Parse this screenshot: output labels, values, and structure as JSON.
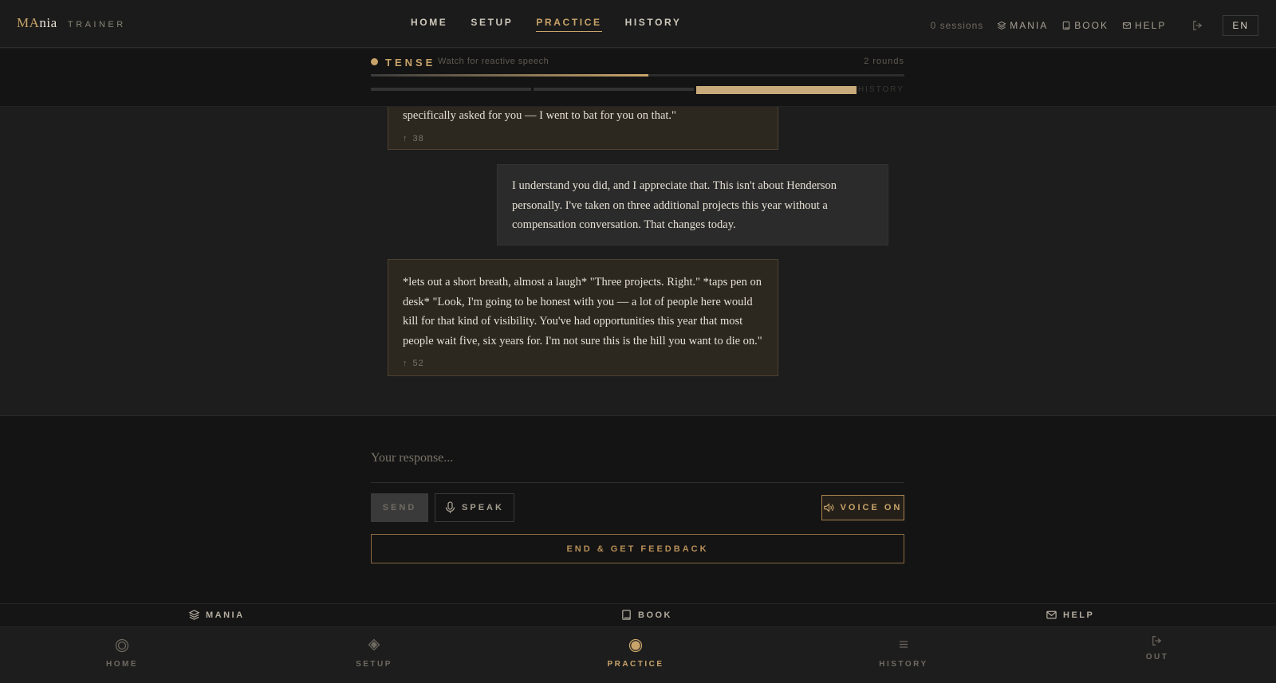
{
  "app": {
    "logo_ma": "MA",
    "logo_nia": "nia",
    "logo_sub": "TRAINER"
  },
  "topnav": [
    {
      "label": "HOME"
    },
    {
      "label": "SETUP"
    },
    {
      "label": "PRACTICE",
      "active": true
    },
    {
      "label": "HISTORY"
    }
  ],
  "topright": {
    "sessions": "0 sessions",
    "mania": "MANIA",
    "book": "BOOK",
    "help": "HELP",
    "lang": "EN"
  },
  "status": {
    "mood": "TENSE",
    "hint": "Watch for reactive speech",
    "rounds": "2 rounds",
    "progress": 0.52,
    "history_label": "HISTORY",
    "segments": [
      false,
      false,
      true
    ]
  },
  "messages": [
    {
      "role": "ai",
      "text": "specifically asked for you — I went to bat for you on that.\"",
      "votes": "38"
    },
    {
      "role": "me",
      "text": "I understand you did, and I appreciate that. This isn't about Henderson personally. I've taken on three additional projects this year without a compensation conversation. That changes today."
    },
    {
      "role": "ai",
      "text": "*lets out a short breath, almost a laugh* \"Three projects. Right.\" *taps pen on desk* \"Look, I'm going to be honest with you — a lot of people here would kill for that kind of visibility. You've had opportunities this year that most people wait five, six years for. I'm not sure this is the hill you want to die on.\"",
      "votes": "52"
    }
  ],
  "composer": {
    "placeholder": "Your response...",
    "send": "SEND",
    "speak": "SPEAK",
    "voice": "VOICE ON",
    "end": "END & GET FEEDBACK"
  },
  "footer_links": {
    "mania": "MANIA",
    "book": "BOOK",
    "help": "HELP"
  },
  "tabs": [
    {
      "label": "HOME",
      "icon": "home-ring-icon"
    },
    {
      "label": "SETUP",
      "icon": "diamond-icon"
    },
    {
      "label": "PRACTICE",
      "icon": "target-icon",
      "active": true
    },
    {
      "label": "HISTORY",
      "icon": "list-icon"
    },
    {
      "label": "OUT",
      "icon": "logout-icon"
    }
  ],
  "colors": {
    "accent": "#c9a46a",
    "background": "#1d1d1d",
    "panel": "#141414"
  }
}
